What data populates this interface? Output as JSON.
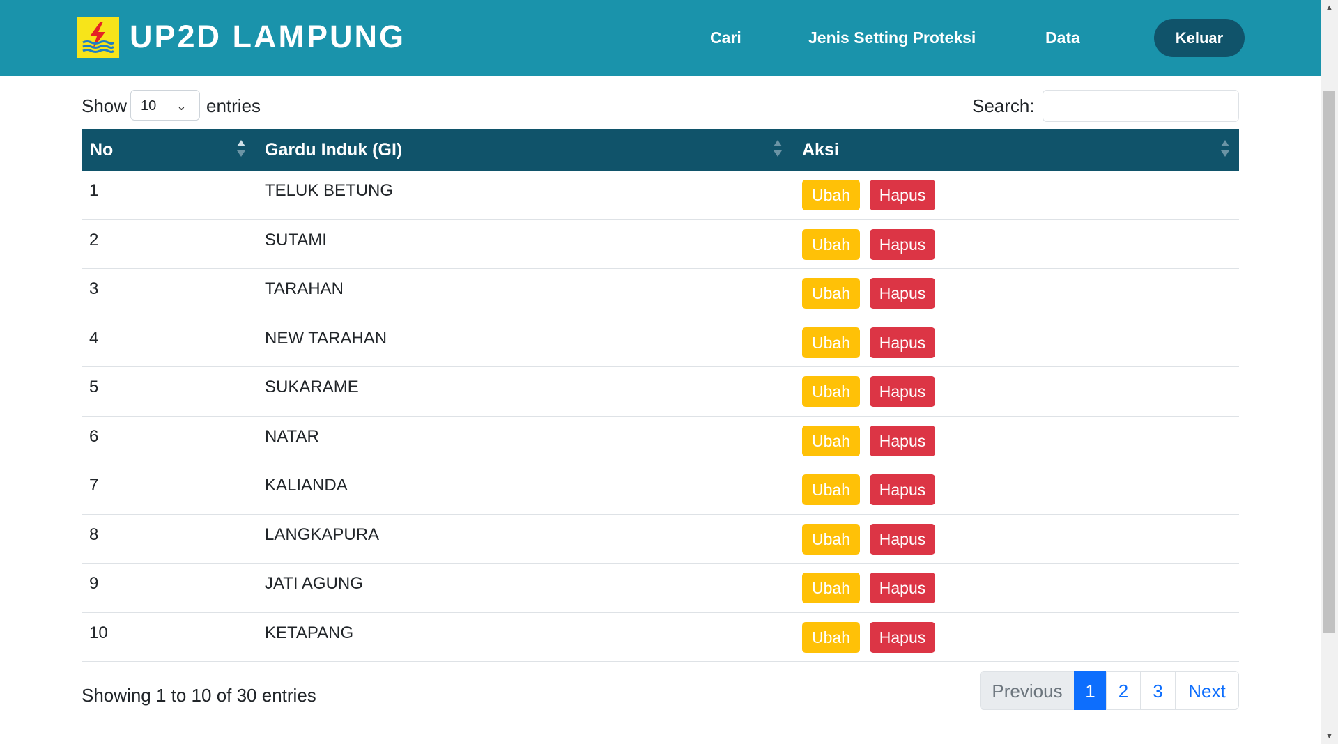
{
  "navbar": {
    "brand": "UP2D LAMPUNG",
    "links": [
      "Cari",
      "Jenis Setting Proteksi",
      "Data"
    ],
    "logout": "Keluar",
    "logo_icon": "pln-lightning-logo-icon",
    "colors": {
      "navbar_bg": "#1a93ab",
      "logout_bg": "#10536a",
      "logo_bg": "#f7e41a"
    }
  },
  "controls": {
    "show_label": "Show",
    "entries_value": "10",
    "entries_label": "entries",
    "search_label": "Search:",
    "search_value": ""
  },
  "table": {
    "columns": [
      "No",
      "Gardu Induk (GI)",
      "Aksi"
    ],
    "rows": [
      {
        "no": "1",
        "gi": "TELUK BETUNG"
      },
      {
        "no": "2",
        "gi": "SUTAMI"
      },
      {
        "no": "3",
        "gi": "TARAHAN"
      },
      {
        "no": "4",
        "gi": "NEW TARAHAN"
      },
      {
        "no": "5",
        "gi": "SUKARAME"
      },
      {
        "no": "6",
        "gi": "NATAR"
      },
      {
        "no": "7",
        "gi": "KALIANDA"
      },
      {
        "no": "8",
        "gi": "LANGKAPURA"
      },
      {
        "no": "9",
        "gi": "JATI AGUNG"
      },
      {
        "no": "10",
        "gi": "KETAPANG"
      }
    ],
    "edit_label": "Ubah",
    "delete_label": "Hapus",
    "header_bg": "#10536a",
    "edit_color": "#ffc107",
    "delete_color": "#dc3545"
  },
  "footer": {
    "info": "Showing 1 to 10 of 30 entries",
    "pagination": {
      "previous": "Previous",
      "pages": [
        "1",
        "2",
        "3"
      ],
      "current": "1",
      "next": "Next"
    },
    "active_page_color": "#0d6efd"
  }
}
